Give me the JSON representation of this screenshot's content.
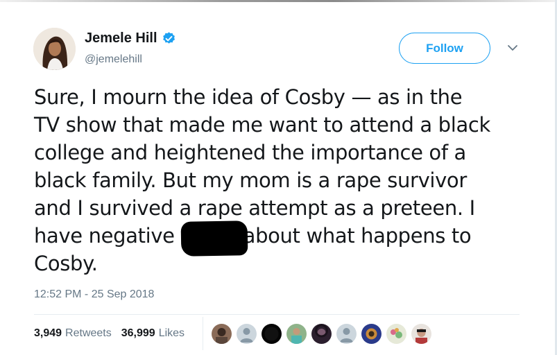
{
  "tweet": {
    "author": {
      "display_name": "Jemele Hill",
      "handle": "@jemelehill",
      "verified": true
    },
    "follow_label": "Follow",
    "text_lines": [
      "Sure, I mourn the idea of Cosby — as in the",
      "TV show that made me want to attend a black",
      "college and heightened the importance of a",
      "black family. But my mom is a rape survivor",
      "and I survived a rape attempt as a preteen. I",
      "have negative",
      "about what happens to",
      "Cosby."
    ],
    "timestamp": "12:52 PM - 25 Sep 2018",
    "retweets": {
      "count": "3,949",
      "label": "Retweets"
    },
    "likes": {
      "count": "36,999",
      "label": "Likes"
    },
    "liker_avatar_icons": [
      "liker-avatar-1",
      "liker-avatar-2",
      "liker-avatar-3",
      "liker-avatar-4",
      "liker-avatar-5",
      "liker-avatar-6",
      "liker-avatar-7",
      "liker-avatar-8",
      "liker-avatar-9"
    ]
  },
  "colors": {
    "accent": "#1da1f2",
    "text": "#14171a",
    "secondary_text": "#657786"
  }
}
